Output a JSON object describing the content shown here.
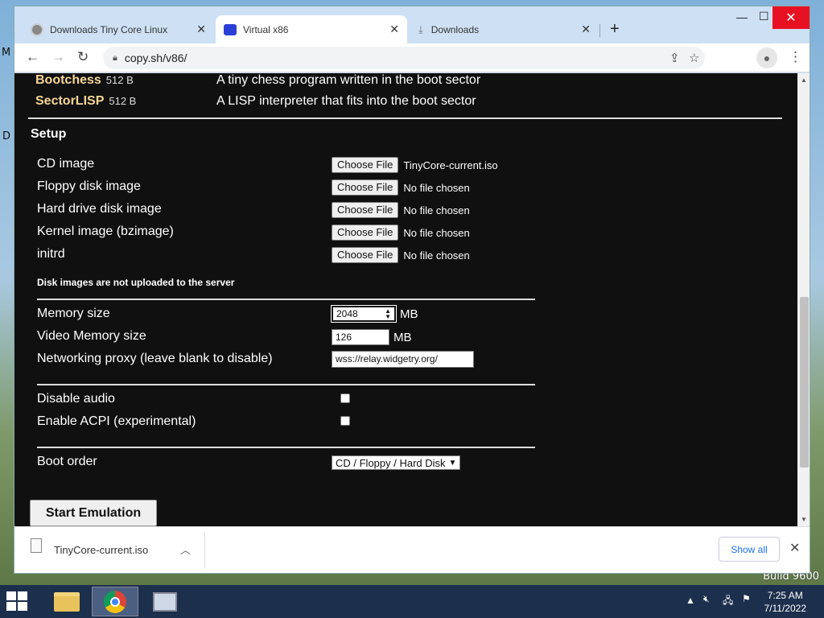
{
  "browser": {
    "tabs": [
      {
        "label": "Downloads Tiny Core Linux"
      },
      {
        "label": "Virtual x86"
      },
      {
        "label": "Downloads"
      }
    ],
    "url": "copy.sh/v86/"
  },
  "os_list": [
    {
      "name": "Bootchess",
      "size": "512 B",
      "desc": "A tiny chess program written in the boot sector"
    },
    {
      "name": "SectorLISP",
      "size": "512 B",
      "desc": "A LISP interpreter that fits into the boot sector"
    }
  ],
  "setup": {
    "title": "Setup",
    "files": [
      {
        "label": "CD image",
        "button": "Choose File",
        "file": "TinyCore-current.iso"
      },
      {
        "label": "Floppy disk image",
        "button": "Choose File",
        "file": "No file chosen"
      },
      {
        "label": "Hard drive disk image",
        "button": "Choose File",
        "file": "No file chosen"
      },
      {
        "label": "Kernel image (bzimage)",
        "button": "Choose File",
        "file": "No file chosen"
      },
      {
        "label": "initrd",
        "button": "Choose File",
        "file": "No file chosen"
      }
    ],
    "note": "Disk images are not uploaded to the server",
    "memory": {
      "label": "Memory size",
      "value": "2048",
      "unit": "MB"
    },
    "vga_memory": {
      "label": "Video Memory size",
      "value": "126",
      "unit": "MB"
    },
    "proxy": {
      "label": "Networking proxy (leave blank to disable)",
      "value": "wss://relay.widgetry.org/"
    },
    "disable_audio": {
      "label": "Disable audio",
      "checked": false
    },
    "acpi": {
      "label": "Enable ACPI (experimental)",
      "checked": false
    },
    "boot_order": {
      "label": "Boot order",
      "value": "CD / Floppy / Hard Disk"
    },
    "start_button": "Start Emulation"
  },
  "download_shelf": {
    "file": "TinyCore-current.iso",
    "show_all": "Show all"
  },
  "desktop": {
    "build": "Build 9600",
    "frag_m": "M",
    "frag_d": "D"
  },
  "taskbar": {
    "time": "7:25 AM",
    "date": "7/11/2022"
  },
  "colors": {
    "page_bg": "#101010",
    "os_name": "#f7d697",
    "link_blue": "#1a73e8"
  }
}
